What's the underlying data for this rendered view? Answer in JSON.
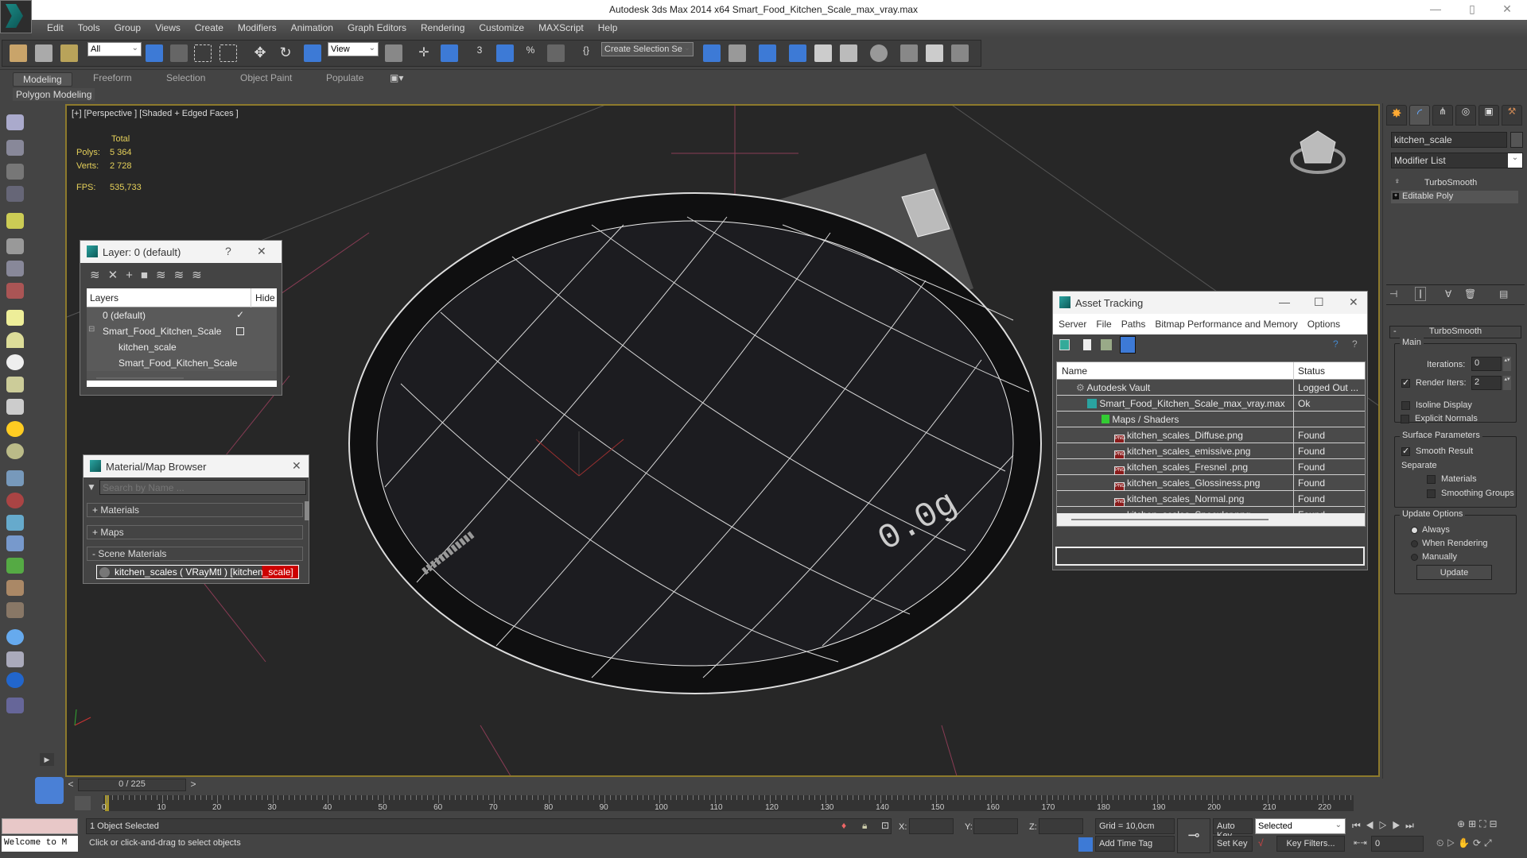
{
  "titlebar": {
    "title": "Autodesk 3ds Max  2014 x64     Smart_Food_Kitchen_Scale_max_vray.max"
  },
  "menu": [
    "Edit",
    "Tools",
    "Group",
    "Views",
    "Create",
    "Modifiers",
    "Animation",
    "Graph Editors",
    "Rendering",
    "Customize",
    "MAXScript",
    "Help"
  ],
  "toolbar": {
    "selection_filter": "All",
    "ref_coord": "View",
    "named_selection": "Create Selection Se"
  },
  "ribbon": {
    "tabs": [
      "Modeling",
      "Freeform",
      "Selection",
      "Object Paint",
      "Populate"
    ],
    "active": "Modeling",
    "panel": "Polygon Modeling"
  },
  "viewport": {
    "label": "[+] [Perspective ] [Shaded + Edged Faces ]",
    "stats": {
      "header": "Total",
      "polys_label": "Polys:",
      "polys": "5 364",
      "verts_label": "Verts:",
      "verts": "2 728",
      "fps_label": "FPS:",
      "fps": "535,733"
    },
    "scale_display": "0.0g"
  },
  "layer_window": {
    "title": "Layer: 0 (default)",
    "help": "?",
    "col_layers": "Layers",
    "col_hide": "Hide",
    "rows": [
      {
        "name": "0 (default)",
        "current": true
      },
      {
        "name": "Smart_Food_Kitchen_Scale",
        "current": false
      },
      {
        "name": "kitchen_scale",
        "current": false
      },
      {
        "name": "Smart_Food_Kitchen_Scale",
        "current": false
      }
    ]
  },
  "material_browser": {
    "title": "Material/Map Browser",
    "search_placeholder": "Search by Name ...",
    "groups": [
      "+ Materials",
      "+ Maps",
      "- Scene Materials"
    ],
    "selected_item": "kitchen_scales  ( VRayMtl ) [kitchen_scale]"
  },
  "asset_tracking": {
    "title": "Asset Tracking",
    "menu": [
      "Server",
      "File",
      "Paths",
      "Bitmap Performance and Memory",
      "Options"
    ],
    "col_name": "Name",
    "col_status": "Status",
    "rows": [
      {
        "name": "Autodesk Vault",
        "status": "Logged Out ...",
        "type": "vault"
      },
      {
        "name": "Smart_Food_Kitchen_Scale_max_vray.max",
        "status": "Ok",
        "type": "max"
      },
      {
        "name": "Maps / Shaders",
        "status": "",
        "type": "folder"
      },
      {
        "name": "kitchen_scales_Diffuse.png",
        "status": "Found",
        "type": "png"
      },
      {
        "name": "kitchen_scales_emissive.png",
        "status": "Found",
        "type": "png"
      },
      {
        "name": "kitchen_scales_Fresnel .png",
        "status": "Found",
        "type": "png"
      },
      {
        "name": "kitchen_scales_Glossiness.png",
        "status": "Found",
        "type": "png"
      },
      {
        "name": "kitchen_scales_Normal.png",
        "status": "Found",
        "type": "png"
      },
      {
        "name": "kitchen_scales_Specular.png",
        "status": "Found",
        "type": "png"
      }
    ]
  },
  "command_panel": {
    "object_name": "kitchen_scale",
    "modifier_list": "Modifier List",
    "stack": [
      "TurboSmooth",
      "Editable Poly"
    ],
    "rollout_title": "TurboSmooth",
    "main_label": "Main",
    "iterations_label": "Iterations:",
    "iterations": "0",
    "render_iters_label": "Render Iters:",
    "render_iters": "2",
    "render_iters_checked": true,
    "isoline_label": "Isoline Display",
    "explicit_normals_label": "Explicit Normals",
    "surface_label": "Surface Parameters",
    "smooth_result_label": "Smooth Result",
    "separate_label": "Separate",
    "materials_label": "Materials",
    "smoothing_groups_label": "Smoothing Groups",
    "update_options_label": "Update Options",
    "always_label": "Always",
    "when_rendering_label": "When Rendering",
    "manually_label": "Manually",
    "update_button": "Update"
  },
  "timeline": {
    "frame_display": "0 / 225",
    "ticks": [
      "0",
      "10",
      "20",
      "30",
      "40",
      "50",
      "60",
      "70",
      "80",
      "90",
      "100",
      "110",
      "120",
      "130",
      "140",
      "150",
      "160",
      "170",
      "180",
      "190",
      "200",
      "210",
      "220"
    ]
  },
  "status": {
    "maxscript": "Welcome to M",
    "selected": "1 Object Selected",
    "prompt": "Click or click-and-drag to select objects",
    "x_label": "X:",
    "y_label": "Y:",
    "z_label": "Z:",
    "grid": "Grid = 10,0cm",
    "add_time_tag": "Add Time Tag",
    "auto_key": "Auto Key",
    "set_key": "Set Key",
    "key_mode": "Selected",
    "key_filters": "Key Filters...",
    "current_frame": "0"
  }
}
